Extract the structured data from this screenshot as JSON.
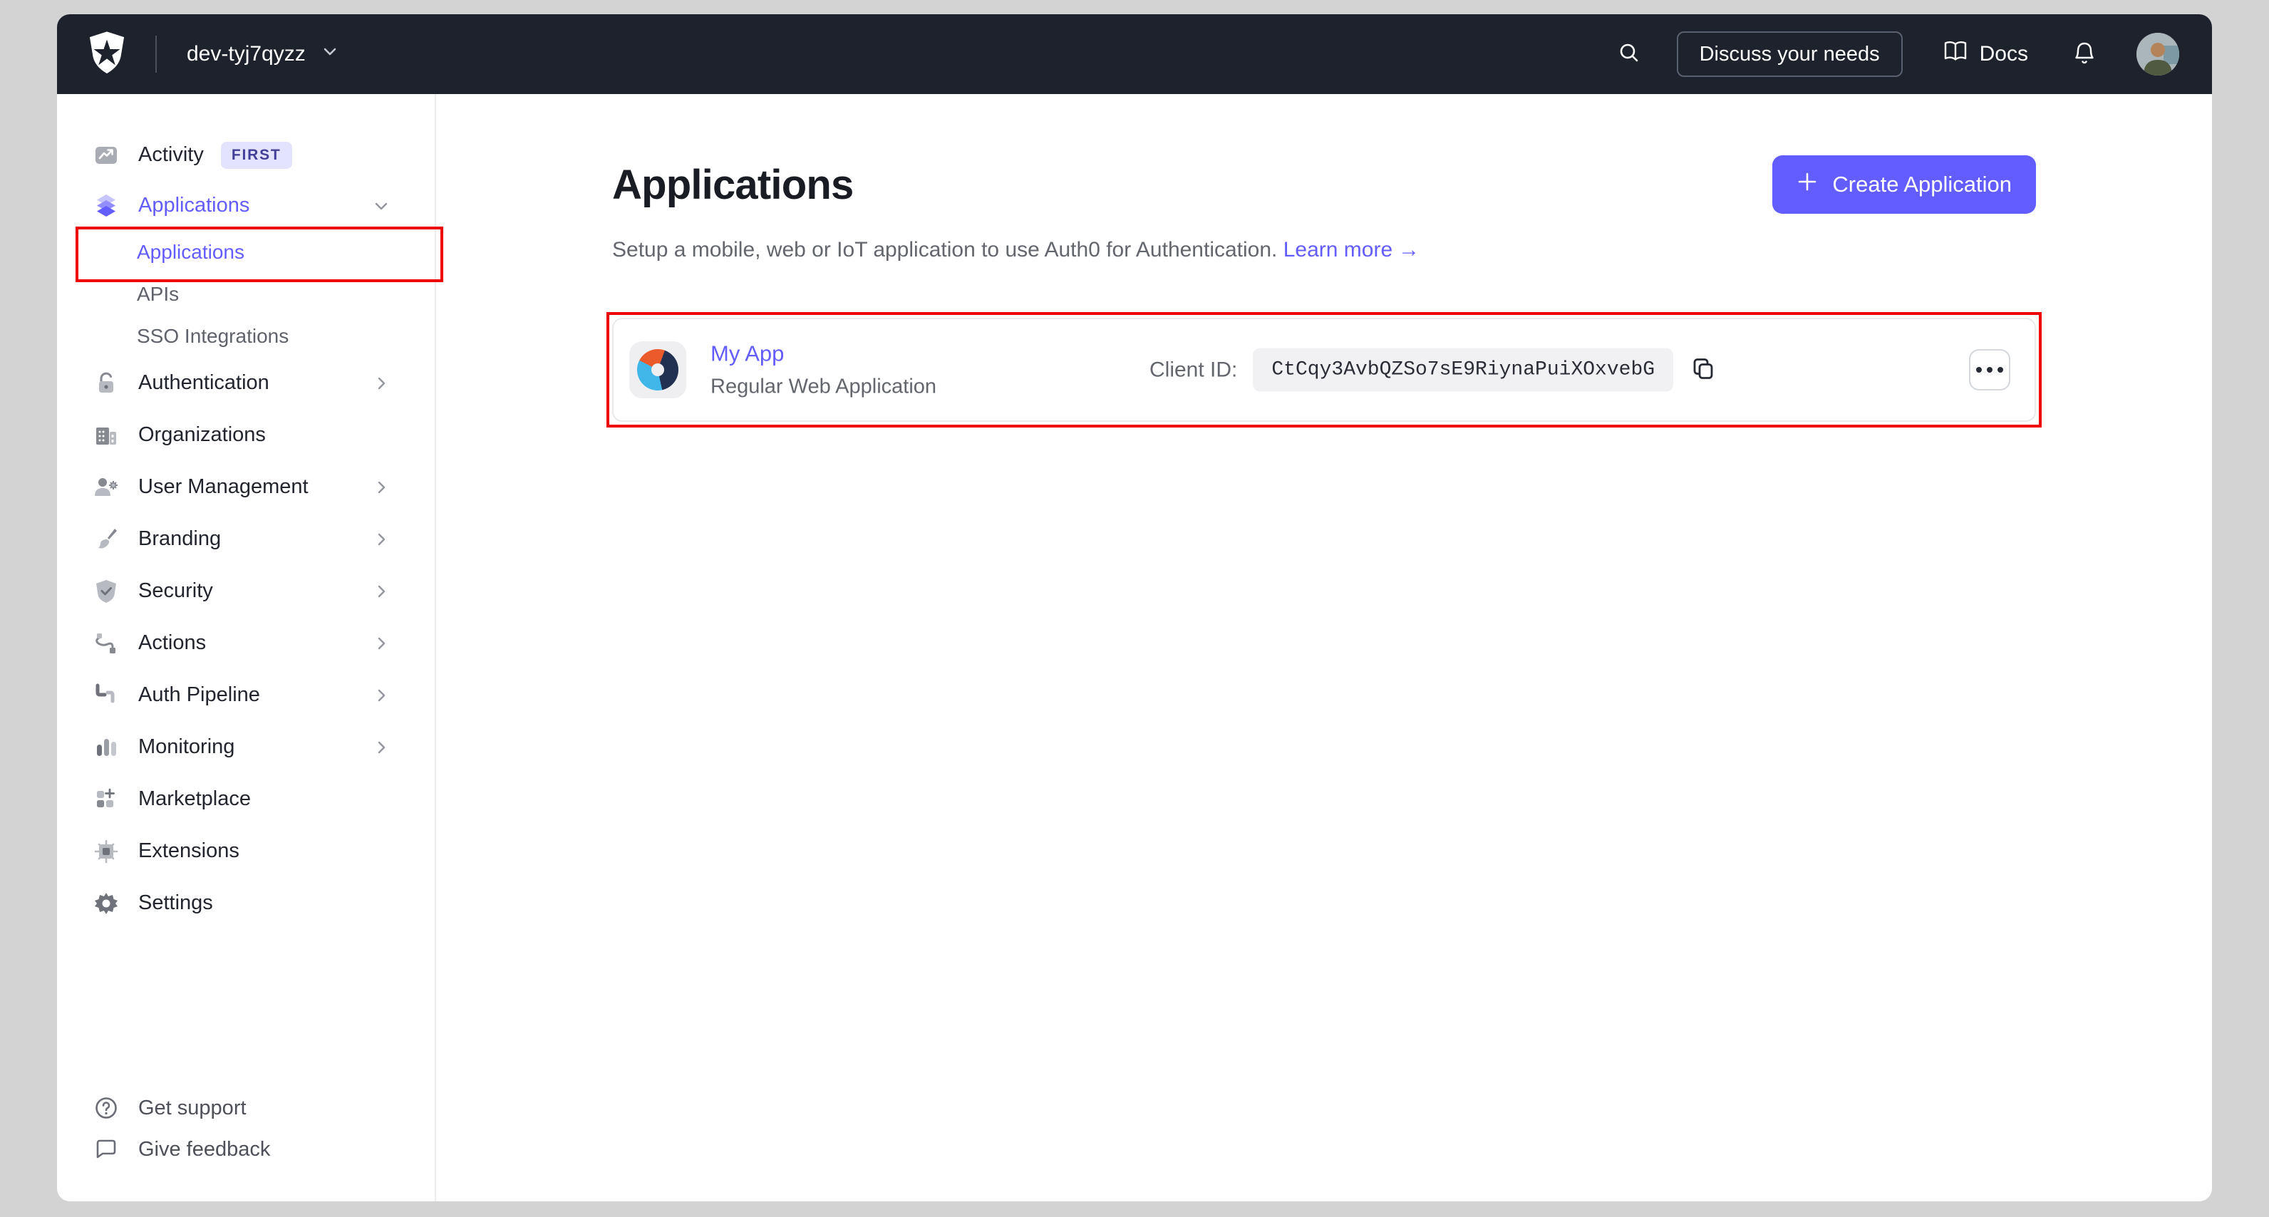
{
  "topbar": {
    "tenant": "dev-tyj7qyzz",
    "discuss_label": "Discuss your needs",
    "docs_label": "Docs",
    "icons": [
      "auth0-logo",
      "chevron-down-icon",
      "search-icon",
      "book-icon",
      "bell-icon",
      "avatar"
    ]
  },
  "sidebar": {
    "items": [
      {
        "label": "Activity",
        "icon": "activity-icon",
        "badge": "FIRST"
      },
      {
        "label": "Applications",
        "icon": "applications-icon",
        "active": true,
        "trailing": "chevron-down-icon",
        "children": [
          {
            "label": "Applications",
            "active": true,
            "annotated": true
          },
          {
            "label": "APIs"
          },
          {
            "label": "SSO Integrations"
          }
        ]
      },
      {
        "label": "Authentication",
        "icon": "lock-icon",
        "trailing": "chevron-right-icon"
      },
      {
        "label": "Organizations",
        "icon": "building-icon"
      },
      {
        "label": "User Management",
        "icon": "user-gear-icon",
        "trailing": "chevron-right-icon"
      },
      {
        "label": "Branding",
        "icon": "paintbrush-icon",
        "trailing": "chevron-right-icon"
      },
      {
        "label": "Security",
        "icon": "shield-check-icon",
        "trailing": "chevron-right-icon"
      },
      {
        "label": "Actions",
        "icon": "flow-icon",
        "trailing": "chevron-right-icon"
      },
      {
        "label": "Auth Pipeline",
        "icon": "pipeline-icon",
        "trailing": "chevron-right-icon"
      },
      {
        "label": "Monitoring",
        "icon": "bar-chart-icon",
        "trailing": "chevron-right-icon"
      },
      {
        "label": "Marketplace",
        "icon": "marketplace-icon"
      },
      {
        "label": "Extensions",
        "icon": "chip-icon"
      },
      {
        "label": "Settings",
        "icon": "gear-icon"
      }
    ],
    "footer": [
      {
        "label": "Get support",
        "icon": "help-circle-icon"
      },
      {
        "label": "Give feedback",
        "icon": "speech-bubble-icon"
      }
    ]
  },
  "main": {
    "title": "Applications",
    "subtitle": "Setup a mobile, web or IoT application to use Auth0 for Authentication.",
    "learn_more_label": "Learn more",
    "learn_more_arrow": "→",
    "create_label": "Create Application",
    "app_row": {
      "name": "My App",
      "type": "Regular Web Application",
      "client_id_label": "Client ID:",
      "client_id": "CtCqy3AvbQZSo7sE9RiynaPuiXOxvebG",
      "icon": "app-logo-donut",
      "actions_icon": "ellipsis-icon"
    }
  },
  "annotations": {
    "color": "#ee0000",
    "boxes": [
      "sidebar-applications-subitem",
      "application-row-card"
    ]
  },
  "colors": {
    "accent": "#635dff",
    "topbar_bg": "#1e222d",
    "page_matte": "#d3d3d4",
    "badge_bg": "#e4e3fd",
    "badge_text": "#423f98",
    "app_icon_orange": "#ea5a2b",
    "app_icon_navy": "#223052",
    "app_icon_blue": "#41b6e8"
  }
}
